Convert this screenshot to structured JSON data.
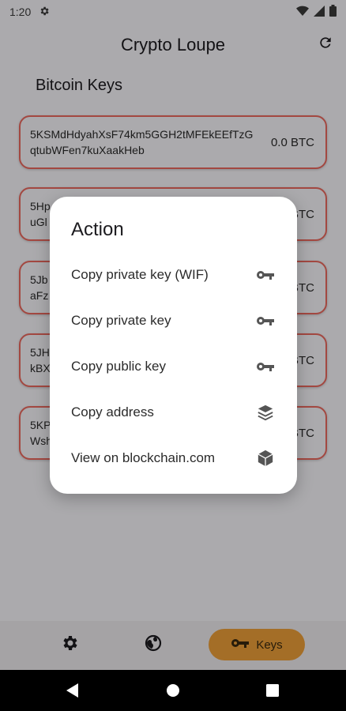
{
  "status_bar": {
    "time": "1:20"
  },
  "app_bar": {
    "title": "Crypto Loupe"
  },
  "section": {
    "title": "Bitcoin Keys"
  },
  "keys": [
    {
      "wif": "5KSMdHdyahXsF74km5GGH2tMFEkEEfTzGqtubWFen7kuXaakHeb",
      "balance": "0.0 BTC"
    },
    {
      "wif": "5Hp\nuGl",
      "balance": "BTC"
    },
    {
      "wif": "5Jb\naFz",
      "balance": "BTC"
    },
    {
      "wif": "5JH\nkBX",
      "balance": "BTC"
    },
    {
      "wif": "5KP\nWsh",
      "balance": "BTC"
    }
  ],
  "dialog": {
    "title": "Action",
    "items": [
      {
        "label": "Copy private key (WIF)",
        "icon": "key-icon"
      },
      {
        "label": "Copy private key",
        "icon": "key-icon"
      },
      {
        "label": "Copy public key",
        "icon": "key-icon"
      },
      {
        "label": "Copy address",
        "icon": "layers-icon"
      },
      {
        "label": "View on blockchain.com",
        "icon": "cube-icon"
      }
    ]
  },
  "bottom_nav": {
    "keys_label": "Keys"
  },
  "colors": {
    "card_border": "#f06b60",
    "nav_active": "#f2a33a"
  }
}
